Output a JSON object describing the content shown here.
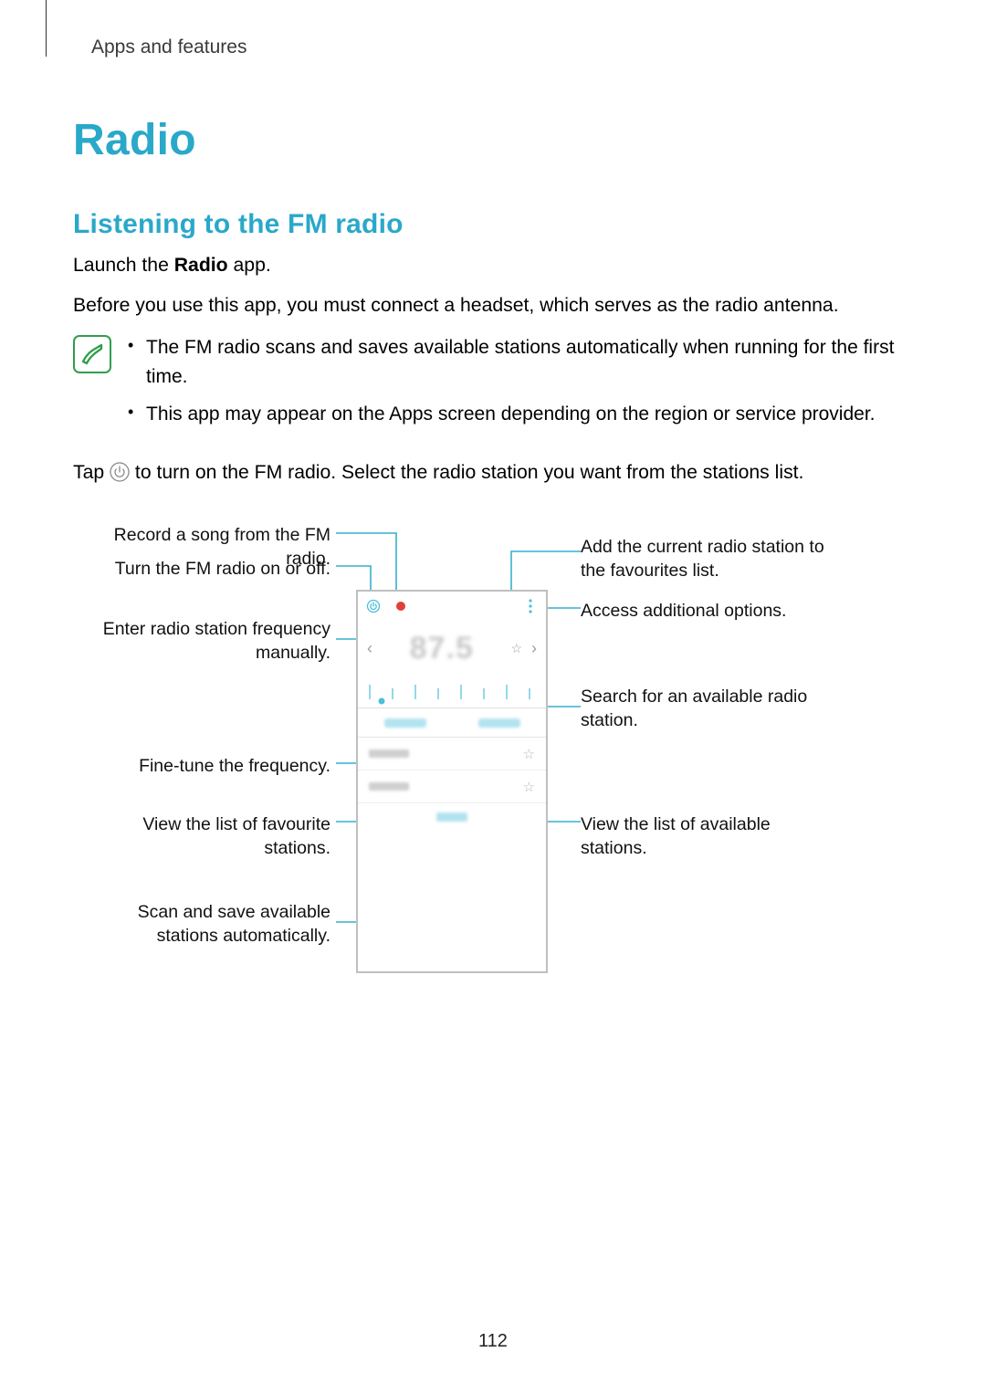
{
  "header": {
    "section": "Apps and features"
  },
  "h1": "Radio",
  "h2": "Listening to the FM radio",
  "para1_pre": "Launch the ",
  "para1_bold": "Radio",
  "para1_post": " app.",
  "para2": "Before you use this app, you must connect a headset, which serves as the radio antenna.",
  "note_bullets": [
    "The FM radio scans and saves available stations automatically when running for the first time.",
    "This app may appear on the Apps screen depending on the region or service provider."
  ],
  "tap_pre": "Tap ",
  "tap_post": " to turn on the FM radio. Select the radio station you want from the stations list.",
  "callouts": {
    "left": [
      "Record a song from the FM radio.",
      "Turn the FM radio on or off.",
      "Enter radio station frequency manually.",
      "Fine-tune the frequency.",
      "View the list of favourite stations.",
      "Scan and save available stations automatically."
    ],
    "right": [
      "Add the current radio station to the favourites list.",
      "Access additional options.",
      "Search for an available radio station.",
      "View the list of available stations."
    ]
  },
  "phone": {
    "frequency": "87.5"
  },
  "page_number": "112"
}
